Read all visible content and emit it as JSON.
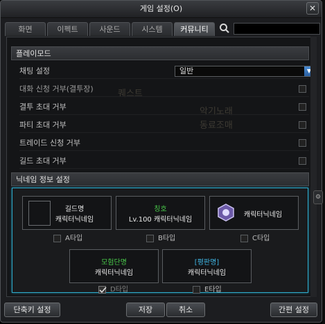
{
  "window": {
    "title": "게임 설정(O)",
    "close": "✕"
  },
  "tabs": [
    "화면",
    "이펙트",
    "사운드",
    "시스템",
    "커뮤니티"
  ],
  "active_tab": "커뮤니티",
  "search": {
    "placeholder": ""
  },
  "play_mode": {
    "heading": "플레이모드",
    "chat_setting": {
      "label": "채팅 설정",
      "value": "일반"
    },
    "rows": [
      "대화 신청 거부(결투장)",
      "결투 초대 거부",
      "파티 초대 거부",
      "트레이드 신청 거부",
      "길드 초대 거부"
    ]
  },
  "background_text": [
    "퀘스트",
    "악기노래",
    "동료조매"
  ],
  "nickname": {
    "heading": "닉네임 정보 설정",
    "cards": [
      {
        "title": "길드명",
        "name": "캐릭터닉네임",
        "option": "A타입"
      },
      {
        "title": "칭호",
        "name": "Lv.100 캐릭터닉네임",
        "option": "B타입"
      },
      {
        "title": "",
        "name": "캐릭터닉네임",
        "option": "C타입"
      },
      {
        "title": "모험단명",
        "name": "캐릭터닉네임",
        "option": "D타입"
      },
      {
        "title": "[평판명]",
        "name": "캐릭터닉네임",
        "option": "E타입"
      }
    ]
  },
  "buttons": {
    "shortcut": "단축키 설정",
    "save": "저장",
    "cancel": "취소",
    "simple": "간편 설정"
  },
  "colors": {
    "title_green": "#49c94a",
    "title_cyan": "#3fb7e6",
    "accent_border": "#2ea9c9",
    "select_arrow": "#3a7cc9"
  }
}
